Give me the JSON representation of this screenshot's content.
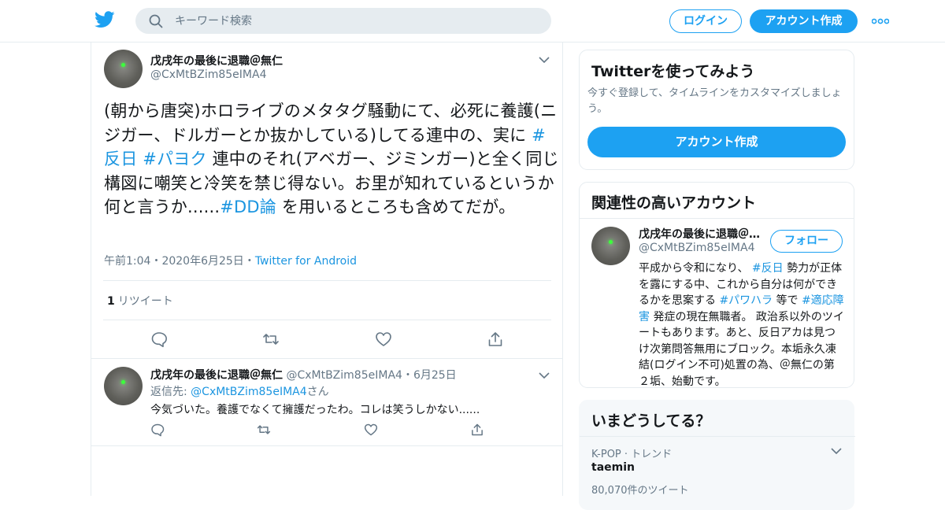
{
  "colors": {
    "accent": "#1da1f2",
    "link": "#1b95e0",
    "muted": "#657786",
    "border": "#e6ecf0"
  },
  "header": {
    "logo_icon": "twitter-bird-icon",
    "search_placeholder": "キーワード検索",
    "login_label": "ログイン",
    "signup_label": "アカウント作成",
    "more_icon": "more-dots-icon"
  },
  "tweet": {
    "author_name": "戊戌年の最後に退職＠無仁",
    "author_handle": "@CxMtBZim85eIMA4",
    "text_parts": {
      "p1": "(朝から唐突)ホロライブのメタタグ騒動にて、必死に養護(ニジガー、ドルガーとか抜かしている)してる連中の、実に ",
      "h1": "#反日",
      "sp1": " ",
      "h2": "#パヨク",
      "p2": " 連中のそれ(アベガー、ジミンガー)と全く同じ構図に嘲笑と冷笑を禁じ得ない。お里が知れているというか何と言うか......",
      "h3": "#DD論",
      "p3": " を用いるところも含めてだが。"
    },
    "time": "午前1:04",
    "sep": "・",
    "date": "2020年6月25日",
    "source": "Twitter for Android",
    "retweet_count": "1",
    "retweet_label": "リツイート"
  },
  "reply": {
    "author_name": "戊戌年の最後に退職＠無仁",
    "author_handle": "@CxMtBZim85eIMA4",
    "date_sep": "・",
    "date": "6月25日",
    "replying_to_label": "返信先: ",
    "replying_to_handle": "@CxMtBZim85eIMA4",
    "replying_to_suffix": "さん",
    "text": "今気づいた。養護でなくて擁護だったわ。コレは笑うしかない......"
  },
  "sidebar": {
    "signup_card": {
      "title": "Twitterを使ってみよう",
      "description": "今すぐ登録して、タイムラインをカスタマイズしましょう。",
      "button": "アカウント作成"
    },
    "related": {
      "title": "関連性の高いアカウント",
      "name": "戊戌年の最後に退職＠無仁",
      "handle": "@CxMtBZim85eIMA4",
      "follow_label": "フォロー",
      "bio_parts": {
        "b1": "平成から令和になり、 ",
        "h1": "#反日",
        "b2": " 勢力が正体を露にする中、これから自分は何ができるかを思案する ",
        "h2": "#パワハラ",
        "b3": " 等で ",
        "h3": "#適応障害",
        "b4": " 発症の現在無職者。 政治系以外のツイートもあります。あと、反日アカは見つけ次第問答無用にブロック。本垢永久凍結(ログイン不可)処置の為、＠無仁の第２垢、始動です。"
      }
    },
    "trends": {
      "title": "いまどうしてる？",
      "items": [
        {
          "meta": "K-POP · トレンド",
          "name": "taemin",
          "count": "80,070件のツイート"
        }
      ]
    }
  }
}
